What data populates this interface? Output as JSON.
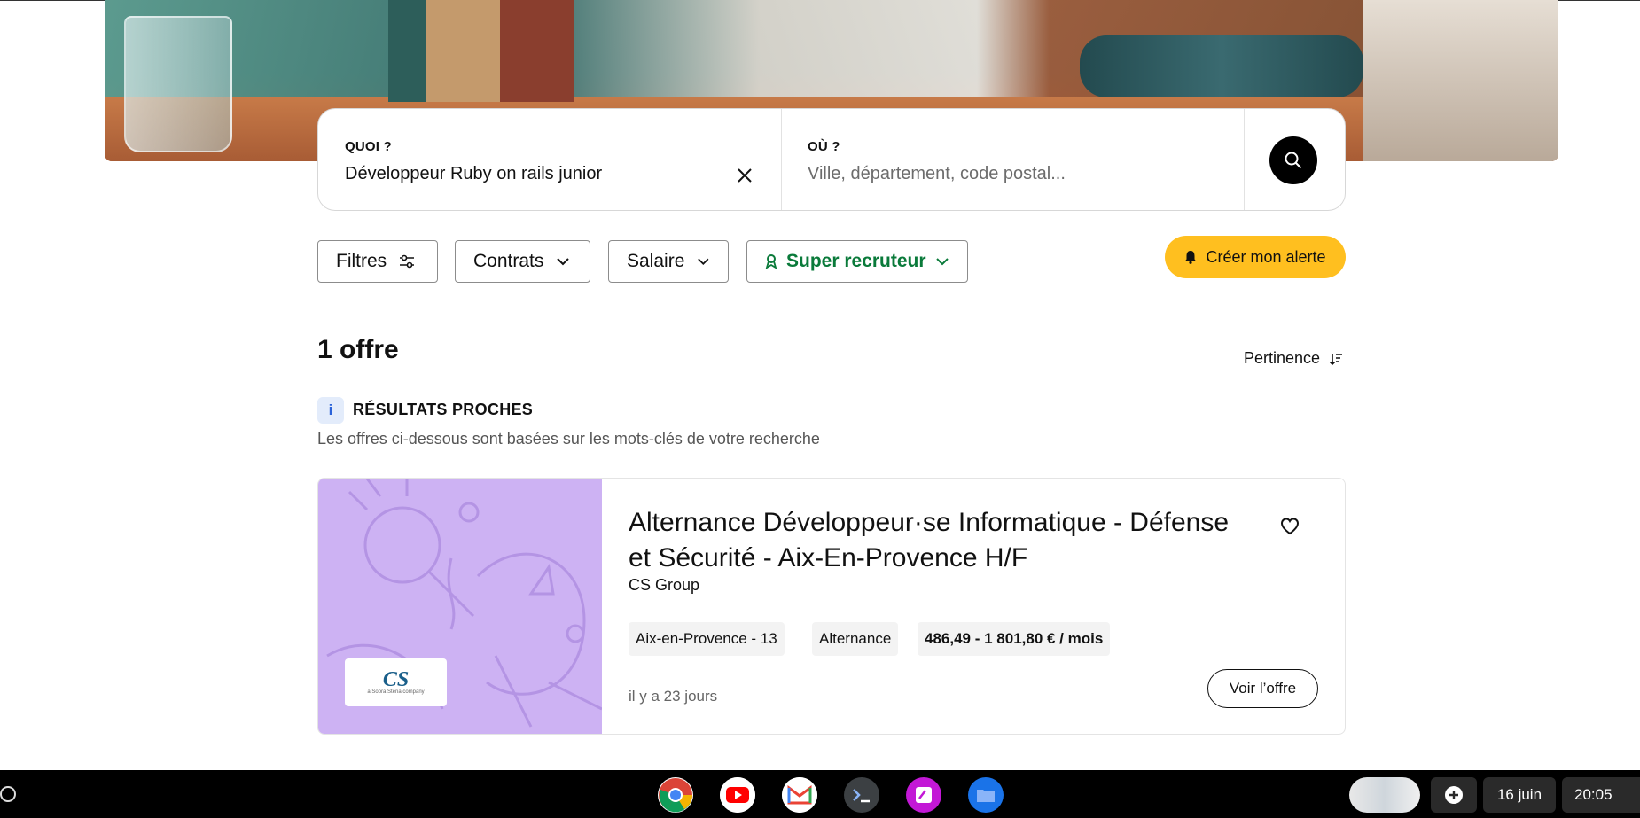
{
  "search": {
    "what_label": "QUOI ?",
    "what_value": "Développeur Ruby on rails junior",
    "where_label": "OÙ ?",
    "where_placeholder": "Ville, département, code postal..."
  },
  "filters": {
    "filtres": "Filtres",
    "contrats": "Contrats",
    "salaire": "Salaire",
    "super_recruteur": "Super recruteur",
    "alert": "Créer mon alerte"
  },
  "results": {
    "count": "1 offre",
    "sort": "Pertinence",
    "info_icon": "i",
    "info_title": "RÉSULTATS PROCHES",
    "info_desc": "Les offres ci-dessous sont basées sur les mots-clés de votre recherche"
  },
  "job": {
    "title": "Alternance Développeur·se Informatique - Défense et Sécurité - Aix-En-Provence H/F",
    "company": "CS Group",
    "logo_text": "CS",
    "logo_sub": "a Sopra Steria company",
    "tags": [
      "Aix-en-Provence - 13",
      "Alternance",
      "486,49 - 1 801,80 € / mois"
    ],
    "date": "il y a 23 jours",
    "view_button": "Voir l’offre"
  },
  "taskbar": {
    "apps": [
      "chrome-icon",
      "youtube-icon",
      "gmail-icon",
      "terminal-icon",
      "canvas-icon",
      "files-icon"
    ],
    "date": "16 juin",
    "time": "20:05"
  },
  "colors": {
    "accent_yellow": "#ffbf1f",
    "green": "#0a7a3a",
    "card_purple": "#cdb2f3"
  }
}
